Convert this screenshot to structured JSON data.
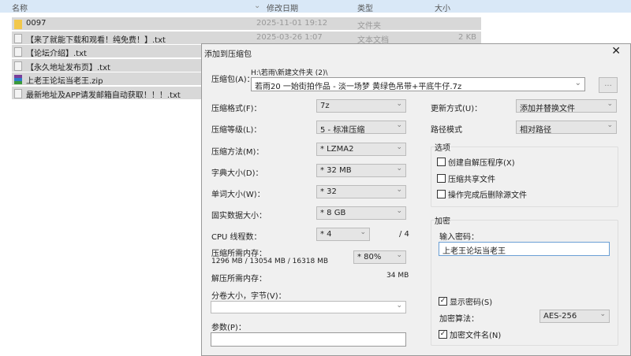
{
  "header": {
    "name": "名称",
    "date": "修改日期",
    "type": "类型",
    "size": "大小"
  },
  "files": [
    {
      "name": "0097",
      "date": "2025-11-01 19:12",
      "type": "文件夹",
      "size": "",
      "icon": "folder-icon"
    },
    {
      "name": "【来了就能下载和观看！纯免费！】.txt",
      "date": "2025-03-26 1:07",
      "type": "文本文档",
      "size": "2 KB",
      "icon": "text-file-icon"
    },
    {
      "name": "【论坛介绍】.txt",
      "date": "",
      "type": "",
      "size": "",
      "icon": "text-file-icon"
    },
    {
      "name": "【永久地址发布页】.txt",
      "date": "",
      "type": "",
      "size": "",
      "icon": "text-file-icon"
    },
    {
      "name": "上老王论坛当老王.zip",
      "date": "",
      "type": "",
      "size": "",
      "icon": "zip-archive-icon"
    },
    {
      "name": "最新地址及APP请发邮箱自动获取！！！.txt",
      "date": "",
      "type": "",
      "size": "",
      "icon": "text-file-icon"
    }
  ],
  "dialog": {
    "title": "添加到压缩包",
    "close": "✕",
    "archive_label": "压缩包(A)：",
    "archive_path": "H:\\若雨\\新建文件夹 (2)\\",
    "archive_name": "若雨20 一始街拍作品 - 淡一场梦 黄绿色吊带+平底牛仔.7z",
    "browse": "...",
    "format_label": "压缩格式(F)：",
    "format": "7z",
    "level_label": "压缩等级(L)：",
    "level": "5 - 标准压缩",
    "method_label": "压缩方法(M)：",
    "method": "* LZMA2",
    "dict_label": "字典大小(D)：",
    "dict": "* 32 MB",
    "word_label": "单词大小(W)：",
    "word": "* 32",
    "solid_label": "固实数据大小：",
    "solid": "* 8 GB",
    "cpu_label": "CPU 线程数：",
    "cpu": "* 4",
    "cpu_max": "/ 4",
    "mem_label": "压缩所需内存：",
    "mem_value": "1296 MB / 13054 MB / 16318 MB",
    "mem_pct": "* 80%",
    "dmem_label": "解压所需内存：",
    "dmem_value": "34 MB",
    "volume_label": "分卷大小，字节(V)：",
    "volume": "",
    "params_label": "参数(P)：",
    "params": "",
    "update_label": "更新方式(U)：",
    "update": "添加并替换文件",
    "path_label": "路径模式",
    "path": "相对路径",
    "options_title": "选项",
    "opt_sfx": "创建自解压程序(X)",
    "opt_shared": "压缩共享文件",
    "opt_delete": "操作完成后删除源文件",
    "enc_title": "加密",
    "pwd_label": "输入密码：",
    "password": "上老王论坛当老王",
    "show_pwd": "显示密码(S)",
    "enc_method_label": "加密算法：",
    "enc_method": "AES-256",
    "enc_names": "加密文件名(N)",
    "checks": {
      "sfx": false,
      "shared": false,
      "delete": false,
      "show_pwd": true,
      "enc_names": true
    }
  }
}
